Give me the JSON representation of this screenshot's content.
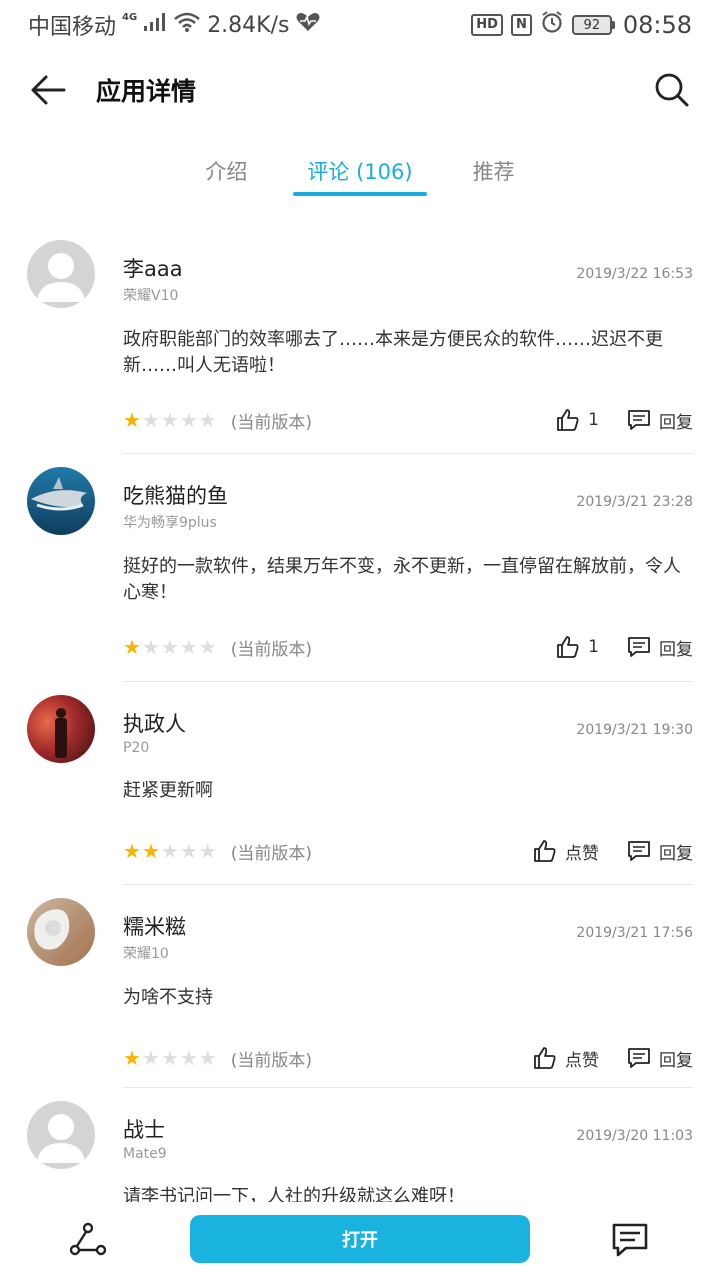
{
  "status": {
    "carrier": "中国移动",
    "network": "4G",
    "speed": "2.84K/s",
    "hd": "HD",
    "nfc": "N",
    "battery": "92",
    "time": "08:58"
  },
  "header": {
    "title": "应用详情"
  },
  "tabs": [
    {
      "label": "介绍"
    },
    {
      "label": "评论 (106)",
      "active": true
    },
    {
      "label": "推荐"
    }
  ],
  "colors": {
    "accent": "#1aaede",
    "star_on": "#f7b500",
    "star_off": "#dedede"
  },
  "reviews": [
    {
      "name": "李aaa",
      "device": "荣耀V10",
      "date": "2019/3/22 16:53",
      "text": "政府职能部门的效率哪去了……本来是方便民众的软件……迟迟不更新……叫人无语啦！",
      "rating": 1,
      "version": "(当前版本)",
      "like": "1",
      "reply": "回复",
      "avatar": "default-avatar"
    },
    {
      "name": "吃熊猫的鱼",
      "device": "华为畅享9plus",
      "date": "2019/3/21 23:28",
      "text": "挺好的一款软件，结果万年不变，永不更新，一直停留在解放前，令人心寒！",
      "rating": 1,
      "version": "(当前版本)",
      "like": "1",
      "reply": "回复",
      "avatar": "shark-photo-avatar"
    },
    {
      "name": "执政人",
      "device": "P20",
      "date": "2019/3/21 19:30",
      "text": "赶紧更新啊",
      "rating": 2,
      "version": "(当前版本)",
      "like": "点赞",
      "reply": "回复",
      "avatar": "person-photo-avatar"
    },
    {
      "name": "糯米糍",
      "device": "荣耀10",
      "date": "2019/3/21 17:56",
      "text": "为啥不支持",
      "rating": 1,
      "version": "(当前版本)",
      "like": "点赞",
      "reply": "回复",
      "avatar": "plush-photo-avatar"
    },
    {
      "name": "战士",
      "device": "Mate9",
      "date": "2019/3/20 11:03",
      "text": "请李书记问一下，人社的升级就这么难呀！",
      "avatar": "default-avatar"
    }
  ],
  "bottom": {
    "open_label": "打开"
  }
}
